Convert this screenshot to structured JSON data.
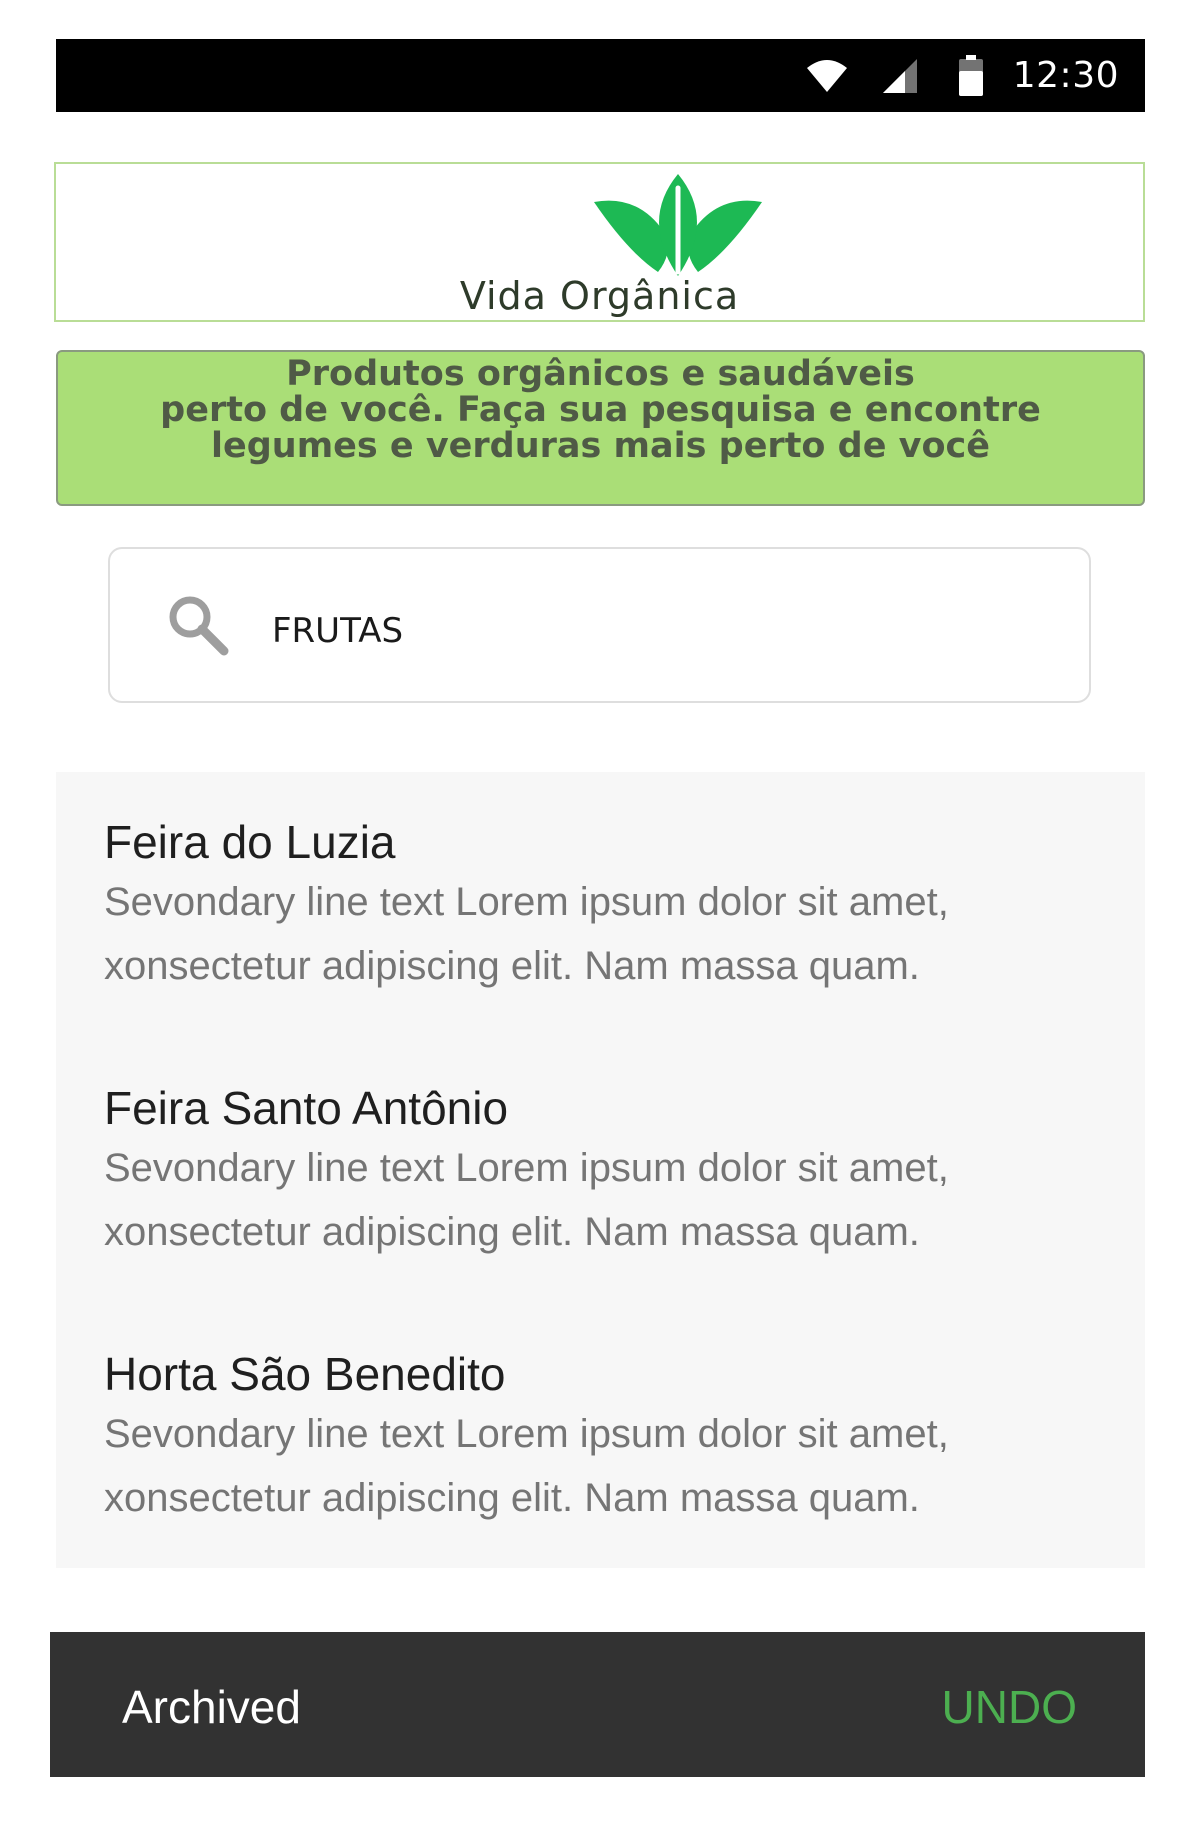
{
  "status_bar": {
    "time": "12:30",
    "icons": [
      "wifi-icon",
      "signal-icon",
      "battery-icon"
    ]
  },
  "logo": {
    "text": "Vida Orgânica",
    "icon": "leaf-icon",
    "color": "#1db954"
  },
  "tagline": {
    "lines": [
      "Produtos orgânicos e saudáveis",
      "perto de você. Faça sua pesquisa e encontre",
      "legumes e verduras mais perto de você"
    ],
    "background": "#aade77"
  },
  "search": {
    "icon": "search-icon",
    "value": "FRUTAS"
  },
  "results": [
    {
      "title": "Feira do Luzia",
      "subtitle_line1": "Sevondary line text Lorem ipsum dolor sit amet,",
      "subtitle_line2": "xonsectetur adipiscing elit. Nam massa quam."
    },
    {
      "title": "Feira Santo Antônio",
      "subtitle_line1": "Sevondary line text Lorem ipsum dolor sit amet,",
      "subtitle_line2": "xonsectetur adipiscing elit. Nam massa quam."
    },
    {
      "title": "Horta São Benedito",
      "subtitle_line1": "Sevondary line text Lorem ipsum dolor sit amet,",
      "subtitle_line2": "xonsectetur adipiscing elit. Nam massa quam."
    }
  ],
  "snackbar": {
    "message": "Archived",
    "action": "UNDO",
    "action_color": "#4caf50"
  }
}
